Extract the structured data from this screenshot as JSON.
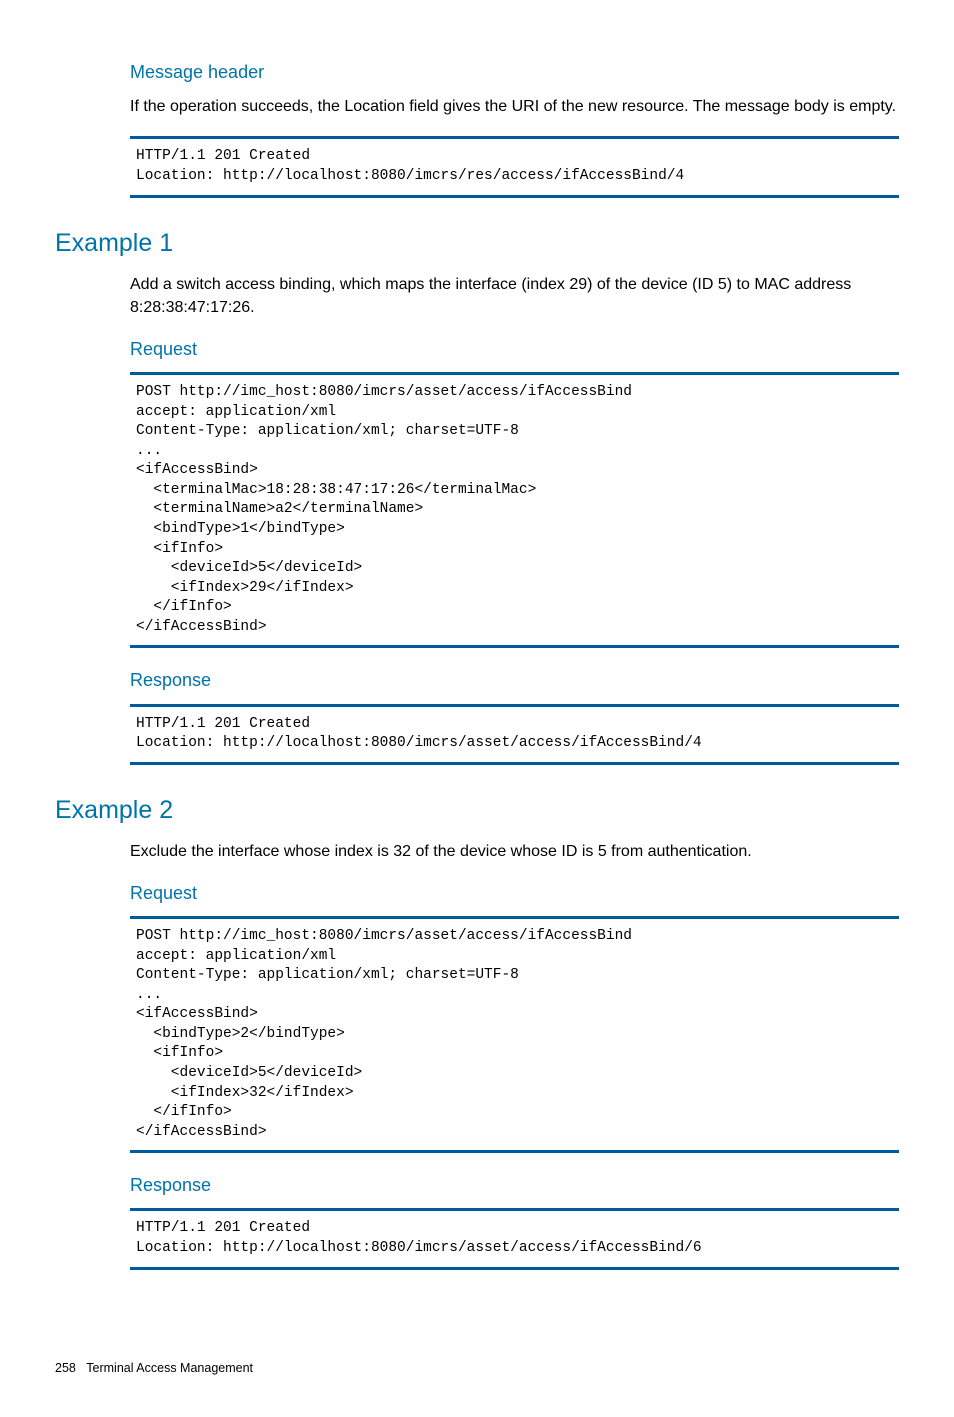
{
  "sections": {
    "msgHeader": {
      "title": "Message header",
      "text": "If the operation succeeds, the Location field gives the URI of the new resource. The message body is empty.",
      "code": "HTTP/1.1 201 Created\nLocation: http://localhost:8080/imcrs/res/access/ifAccessBind/4"
    },
    "example1": {
      "title": "Example 1",
      "text": "Add a switch access binding, which maps the interface (index 29) of the device (ID 5) to MAC address 8:28:38:47:17:26.",
      "requestTitle": "Request",
      "requestCode": "POST http://imc_host:8080/imcrs/asset/access/ifAccessBind\naccept: application/xml\nContent-Type: application/xml; charset=UTF-8\n...\n<ifAccessBind>\n  <terminalMac>18:28:38:47:17:26</terminalMac>\n  <terminalName>a2</terminalName>\n  <bindType>1</bindType>\n  <ifInfo>\n    <deviceId>5</deviceId>\n    <ifIndex>29</ifIndex>\n  </ifInfo>\n</ifAccessBind>",
      "responseTitle": "Response",
      "responseCode": "HTTP/1.1 201 Created\nLocation: http://localhost:8080/imcrs/asset/access/ifAccessBind/4"
    },
    "example2": {
      "title": "Example 2",
      "text": "Exclude the interface whose index is 32 of the device whose ID is 5 from authentication.",
      "requestTitle": "Request",
      "requestCode": "POST http://imc_host:8080/imcrs/asset/access/ifAccessBind\naccept: application/xml\nContent-Type: application/xml; charset=UTF-8\n...\n<ifAccessBind>\n  <bindType>2</bindType>\n  <ifInfo>\n    <deviceId>5</deviceId>\n    <ifIndex>32</ifIndex>\n  </ifInfo>\n</ifAccessBind>",
      "responseTitle": "Response",
      "responseCode": "HTTP/1.1 201 Created\nLocation: http://localhost:8080/imcrs/asset/access/ifAccessBind/6"
    }
  },
  "footer": {
    "pageNumber": "258",
    "chapter": "Terminal Access Management"
  }
}
